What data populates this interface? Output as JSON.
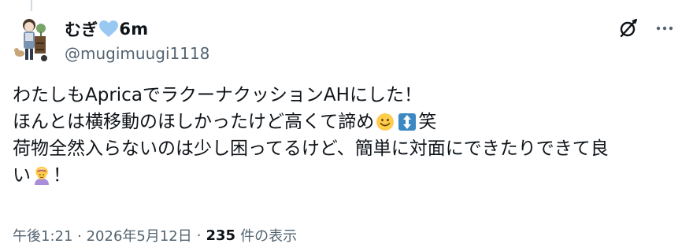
{
  "post": {
    "author": {
      "name_prefix": "むぎ",
      "name_suffix": "6m",
      "handle": "@mugimuugi1118"
    },
    "text_lines": [
      "わたしもApricaでラクーナクッションAHにした！",
      "ほんとは横移動のほしかったけど高くて諦め",
      "笑",
      "荷物全然入らないのは少し困ってるけど、簡単に対面にできたりできて良",
      "い",
      "！"
    ],
    "timestamp": "午後1:21 · 2026年5月12日",
    "views_count": "235",
    "views_label": "件の表示"
  },
  "icons": {
    "heart": "blue-heart-icon",
    "grok": "grok-icon",
    "more": "more-icon",
    "emoji_slight_smile": "slightly-smiling-face-icon",
    "emoji_updown": "up-down-arrow-icon",
    "emoji_raising_hands": "person-gesturing-ok-icon"
  },
  "colors": {
    "text": "#0f1419",
    "secondary": "#536471",
    "heart": "#99c8f3",
    "updown_bg": "#3b88c3"
  }
}
